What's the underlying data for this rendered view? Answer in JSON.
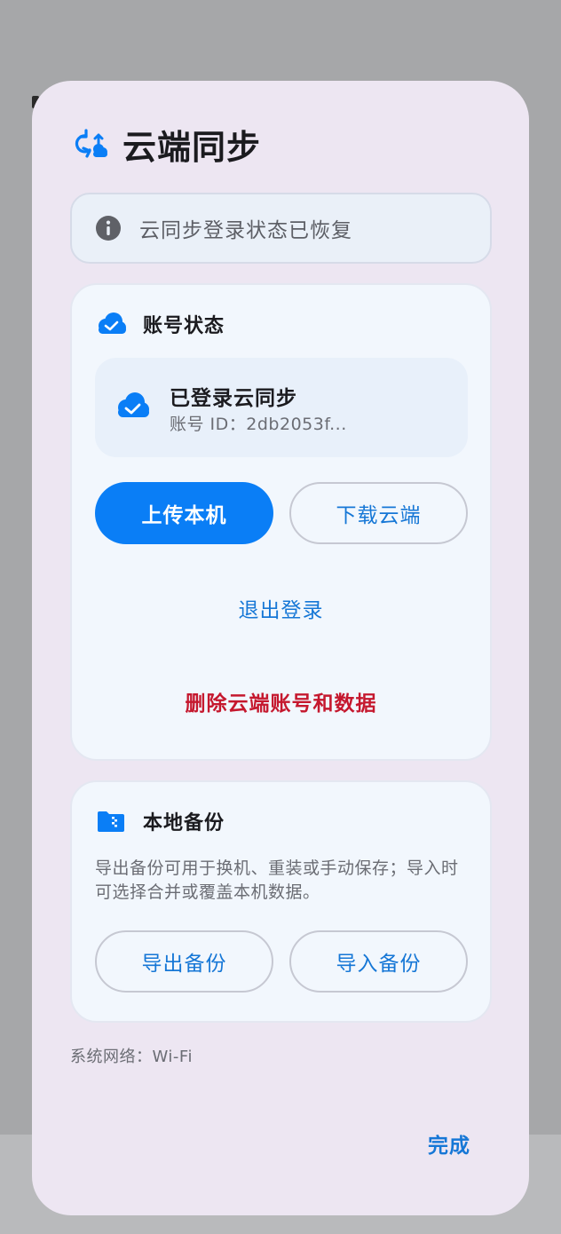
{
  "dialog": {
    "title": "云端同步",
    "title_icon": "cloud-sync-icon",
    "notice": {
      "icon": "info-icon",
      "text": "云同步登录状态已恢复"
    },
    "account": {
      "section_icon": "cloud-check-icon",
      "section_title": "账号状态",
      "status_title": "已登录云同步",
      "status_subtitle": "账号 ID：2db2053f...",
      "upload_label": "上传本机",
      "download_label": "下载云端",
      "logout_label": "退出登录",
      "delete_label": "删除云端账号和数据"
    },
    "backup": {
      "section_icon": "folder-zip-icon",
      "section_title": "本地备份",
      "description": "导出备份可用于换机、重装或手动保存；导入时可选择合并或覆盖本机数据。",
      "export_label": "导出备份",
      "import_label": "导入备份"
    },
    "network": "系统网络：Wi-Fi",
    "done_label": "完成"
  },
  "colors": {
    "accent": "#0a7ef6",
    "link": "#1677d6",
    "danger": "#c5182e",
    "dialog_bg": "#ede6f2",
    "card_bg": "#f2f7fd"
  }
}
